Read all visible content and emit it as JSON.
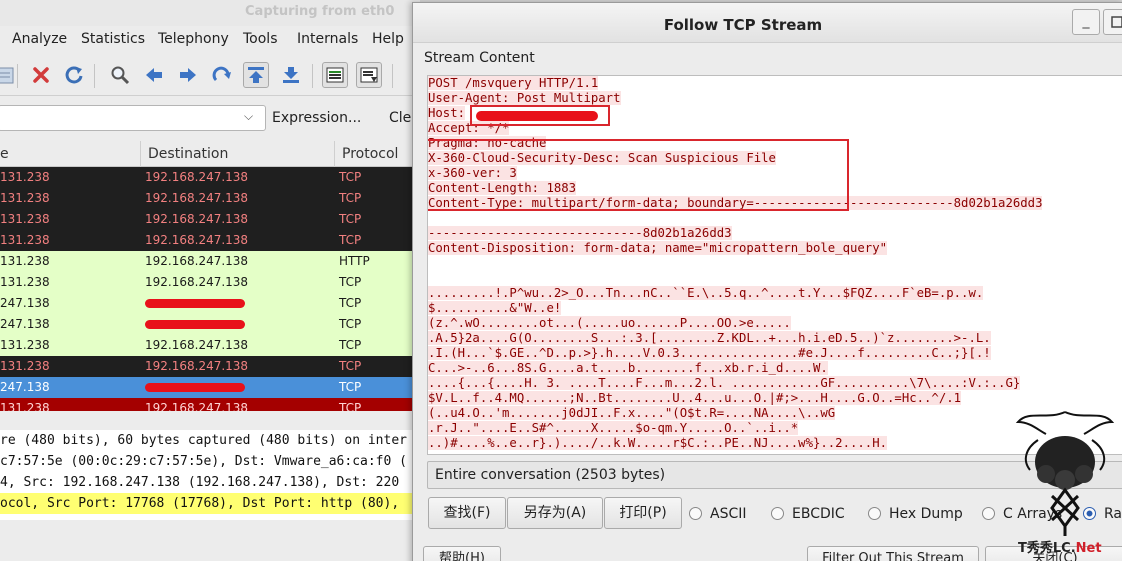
{
  "wireshark": {
    "title": "Capturing from eth0",
    "menu": [
      "Analyze",
      "Statistics",
      "Telephony",
      "Tools",
      "Internals",
      "Help"
    ],
    "filter": {
      "expression_label": "Expression...",
      "clear_label": "Cle"
    },
    "columns": {
      "source": "e",
      "destination": "Destination",
      "protocol": "Protocol"
    },
    "packets": [
      {
        "src": "131.238",
        "dst": "192.168.247.138",
        "proto": "TCP",
        "bg": "#1f1f1f",
        "fg": "#f28080",
        "redacted": false
      },
      {
        "src": "131.238",
        "dst": "192.168.247.138",
        "proto": "TCP",
        "bg": "#1f1f1f",
        "fg": "#f28080",
        "redacted": false
      },
      {
        "src": "131.238",
        "dst": "192.168.247.138",
        "proto": "TCP",
        "bg": "#1f1f1f",
        "fg": "#f28080",
        "redacted": false
      },
      {
        "src": "131.238",
        "dst": "192.168.247.138",
        "proto": "TCP",
        "bg": "#1f1f1f",
        "fg": "#f28080",
        "redacted": false
      },
      {
        "src": "131.238",
        "dst": "192.168.247.138",
        "proto": "HTTP",
        "bg": "#e4ffc7",
        "fg": "#1a1a1a",
        "redacted": false
      },
      {
        "src": "131.238",
        "dst": "192.168.247.138",
        "proto": "TCP",
        "bg": "#e4ffc7",
        "fg": "#1a1a1a",
        "redacted": false
      },
      {
        "src": "247.138",
        "dst": "",
        "proto": "TCP",
        "bg": "#e4ffc7",
        "fg": "#1a1a1a",
        "redacted": true
      },
      {
        "src": "247.138",
        "dst": "",
        "proto": "TCP",
        "bg": "#e4ffc7",
        "fg": "#1a1a1a",
        "redacted": true
      },
      {
        "src": "131.238",
        "dst": "192.168.247.138",
        "proto": "TCP",
        "bg": "#e4ffc7",
        "fg": "#1a1a1a",
        "redacted": false
      },
      {
        "src": "131.238",
        "dst": "192.168.247.138",
        "proto": "TCP",
        "bg": "#1f1f1f",
        "fg": "#f28080",
        "redacted": false
      },
      {
        "src": "247.138",
        "dst": "",
        "proto": "TCP",
        "bg": "#4a90d9",
        "fg": "#ffffff",
        "redacted": true
      },
      {
        "src": "131.238",
        "dst": "192.168.247.138",
        "proto": "TCP",
        "bg": "#a40000",
        "fg": "#ffd3d3",
        "redacted": false
      }
    ],
    "details": [
      "re (480 bits), 60 bytes captured (480 bits) on inter",
      "c7:57:5e (00:0c:29:c7:57:5e), Dst: Vmware_a6:ca:f0 (",
      " 4, Src: 192.168.247.138 (192.168.247.138), Dst: 220",
      "ocol, Src Port: 17768 (17768), Dst Port: http (80),"
    ]
  },
  "dialog": {
    "title": "Follow TCP Stream",
    "minimize_glyph": "_",
    "stream_label": "Stream Content",
    "stream_lines": [
      "POST /msvquery HTTP/1.1",
      "User-Agent: Post Multipart",
      "Host:",
      "Accept: */*",
      "Pragma: no-cache",
      "X-360-Cloud-Security-Desc: Scan Suspicious File",
      "x-360-ver: 3",
      "Content-Length: 1883",
      "Content-Type: multipart/form-data; boundary=---------------------------8d02b1a26dd3",
      "",
      "-----------------------------8d02b1a26dd3",
      "Content-Disposition: form-data; name=\"micropattern_bole_query\"",
      "",
      "",
      ".........!.P^wu..2>_O...Tn...nC..``E.\\..5.q..^....t.Y...$FQZ....F`eB=.p..w.",
      "$..........&\"W..e!",
      "(z.^.wO........ot...(.....uo......P....OO.>e.....",
      ".A.5}2a....G(O........S...:.3.[........Z.KDL..+...h.i.eD.5..)`z........>-.L.",
      ".I.(H...`$.GE..^D..p.>}.h....V.0.3................#e.J....f.........C..;}[.!",
      "C...>-..6...8S.G....a.t....b........f...xb.r.i_d....W.",
      "....{...{....H. 3. ....T....F...m...2.l. ............GF..........\\7\\....:V.:..G}",
      "$V.L..f..4.MQ......;N..Bt........U..4...u...O.|#;>...H....G.O..=Hc..^/.1",
      "(..u4.O..'m.......j0dJI..F.x....\"(O$t.R=....NA....\\..wG",
      ".r.J..\"....E..S#^.....X.....$o-qm.Y.....O..`..i..*",
      "..)#....%..e..r}.)..../..k.W.....r$C.:..PE..NJ....w%}..2....H."
    ],
    "conversation": "Entire conversation (2503 bytes)",
    "buttons": {
      "find": "查找(F)",
      "save_as": "另存为(A)",
      "print": "打印(P)"
    },
    "formats": [
      "ASCII",
      "EBCDIC",
      "Hex Dump",
      "C Arrays",
      "Raw"
    ],
    "selected_format": "Raw",
    "bottom_buttons": {
      "help": "帮助(H)",
      "filter_out": "Filter Out This Stream",
      "close": "关闭(C)"
    }
  },
  "watermark": {
    "text": "T秀秀LC.",
    "accent": "Net"
  },
  "colors": {
    "highlight_frame": "#d9262d",
    "redaction": "#e8111a",
    "stream_text": "#8b0000"
  }
}
